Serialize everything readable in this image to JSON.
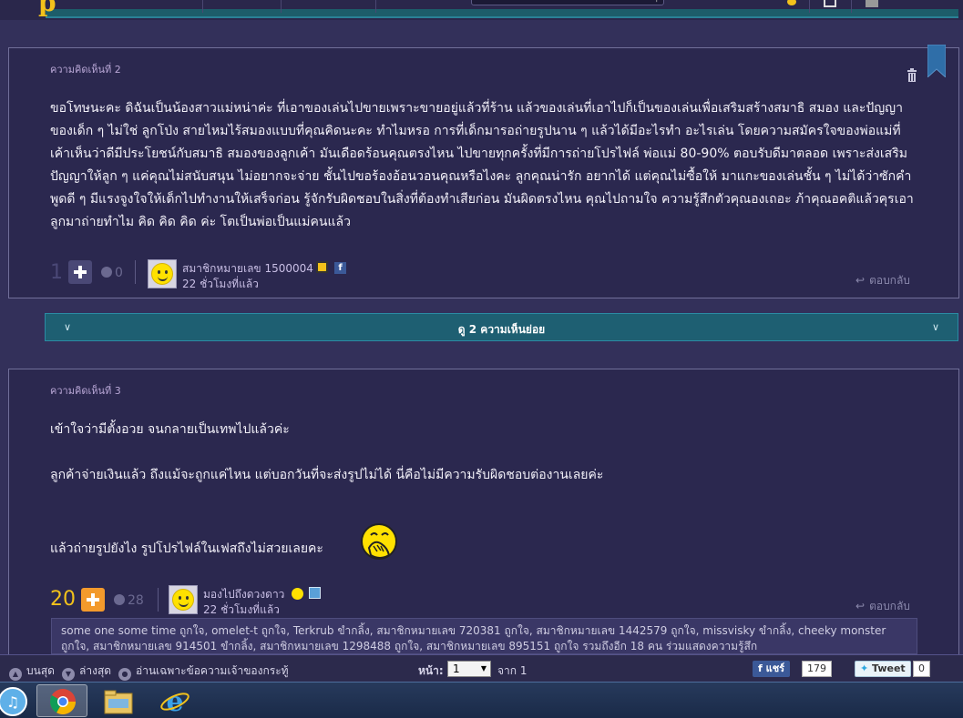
{
  "comments": [
    {
      "number_label": "ความคิดเห็นที่ 2",
      "paragraphs": [
        "ขอโทษนะคะ ดิฉันเป็นน้องสาวแม่หน่าค่ะ ที่เอาของเล่นไปขายเพราะขายอยู่แล้วที่ร้าน แล้วของเล่นที่เอาไปก็เป็นของเล่นเพื่อเสริมสร้างสมาธิ สมอง และปัญญาของเด็ก ๆ ไม่ใช่ ลูกโป่ง สายไหมไร้สมองแบบที่คุณคิดนะคะ ทำไมหรอ การที่เด็กมารอถ่ายรูปนาน ๆ แล้วได้มีอะไรทำ อะไรเล่น โดยความสมัครใจของพ่อแม่ที่เค้าเห็นว่าดีมีประโยชน์กับสมาธิ สมองของลูกเค้า มันเดือดร้อนคุณตรงไหน ไปขายทุกครั้งที่มีการถ่ายโปรไฟล์ พ่อแม่ 80-90% ตอบรับดีมาตลอด เพราะส่งเสริมปัญญาให้ลูก ๆ แค่คุณไม่สนับสนุน ไม่อยากจะจ่าย ชั้นไปขอร้องอ้อนวอนคุณหรือไงคะ ลูกคุณน่ารัก อยากได้ แต่คุณไม่ซื้อให้ มาแกะของเล่นชั้น ๆ ไม่ได้ว่าซักคำ พูดดี ๆ มีแรงจูงใจให้เด็กไปทำงานให้เสร็จก่อน รู้จักรับผิดชอบในสิ่งที่ต้องทำเสียก่อน มันผิดตรงไหน คุณไปถามใจ ความรู้สึกตัวคุณองเถอะ ภ้าคุณอคติแล้วคุรเอาลูกมาถ่ายทำไม คิด คิด คิด ค่ะ โตเป็นพ่อเป็นแม่คนแล้ว"
      ],
      "score": "1",
      "emotion_count": "0",
      "user": "สมาชิกหมายเลข 1500004",
      "time": "22 ชั่วโมงที่แล้ว",
      "reply_label": "ตอบกลับ"
    },
    {
      "number_label": "ความคิดเห็นที่ 3",
      "paragraphs": [
        "เข้าใจว่ามีตั้งอวย จนกลายเป็นเทพไปแล้วค่ะ",
        "ลูกค้าจ่ายเงินแล้ว ถึงแม้จะถูกแค่ไหน แต่บอกวันที่จะส่งรูปไม่ได้ นี่คือไม่มีความรับผิดชอบต่องานเลยค่ะ",
        "แล้วถ่ายรูปยังไง รูปโปรไฟล์ในเฟสถึงไม่สวยเลยคะ"
      ],
      "score": "20",
      "emotion_count": "28",
      "user": "มองไปถึงดวงดาว",
      "time": "22 ชั่วโมงที่แล้ว",
      "reply_label": "ตอบกลับ",
      "likes_text": "some one some time ถูกใจ, omelet-t ถูกใจ, Terkrub ขำกลิ้ง, สมาชิกหมายเลข 720381 ถูกใจ, สมาชิกหมายเลข 1442579 ถูกใจ, missvisky ขำกลิ้ง, cheeky monster ถูกใจ, สมาชิกหมายเลข 914501 ขำกลิ้ง, สมาชิกหมายเลข 1298488 ถูกใจ, สมาชิกหมายเลข 895151 ถูกใจ รวมถึงอีก 18 คน ร่วมแสดงความรู้สึก"
    }
  ],
  "subcomments_label": "ดู 2 ความเห็นย่อย",
  "bottom": {
    "top_label": "บนสุด",
    "bottom_label": "ล่างสุด",
    "owner_only_label": "อ่านเฉพาะข้อความเจ้าของกระทู้",
    "page_label": "หน้า:",
    "page_value": "1",
    "of_label": "จาก 1",
    "share_label": "แชร์",
    "share_count": "179",
    "tweet_label": "Tweet",
    "tweet_count": "0"
  },
  "colors": {
    "accent_yellow": "#f3c21b",
    "plus_orange": "#f39a2c",
    "panel_bg": "#2b284f",
    "teal_bar": "#1e5f72"
  },
  "icons": [
    "trash-icon",
    "bookmark-icon",
    "plus-icon",
    "emotion-icon",
    "facebook-icon",
    "reply-arrow-icon",
    "smiley-avatar",
    "covering-mouth-emoji",
    "chrome-icon",
    "file-explorer-icon",
    "internet-explorer-icon"
  ]
}
